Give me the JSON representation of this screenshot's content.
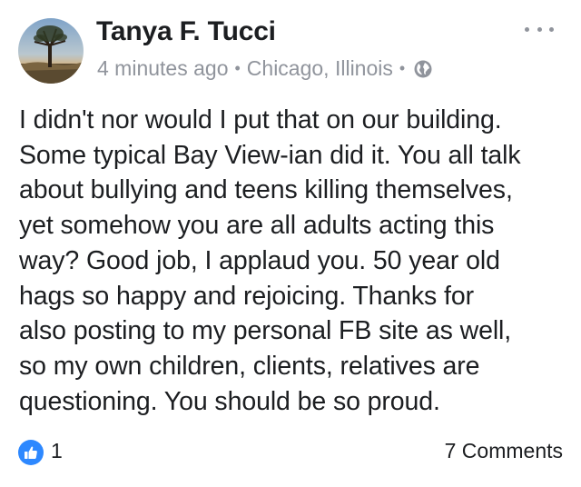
{
  "post": {
    "author": "Tanya F. Tucci",
    "time": "4 minutes ago",
    "location": "Chicago, Illinois",
    "privacy_icon": "globe-icon",
    "menu_icon": "more-options-icon",
    "text": "I didn't nor would I put that on our building.\nSome typical Bay View-ian did it.  You all talk\nabout bullying and teens killing themselves,\nyet somehow you are all adults acting this\nway?  Good job,  I applaud you.  50 year old\nhags so happy and rejoicing. Thanks for\nalso posting to my personal FB site as well,\nso my own children, clients, relatives are\nquestioning. You should be so proud.",
    "reactions": {
      "icon": "thumbs-up-icon",
      "count": "1"
    },
    "comments": "7 Comments"
  },
  "colors": {
    "like_blue": "#2d88ff",
    "meta_gray": "#90949c",
    "text": "#1c1e21"
  }
}
